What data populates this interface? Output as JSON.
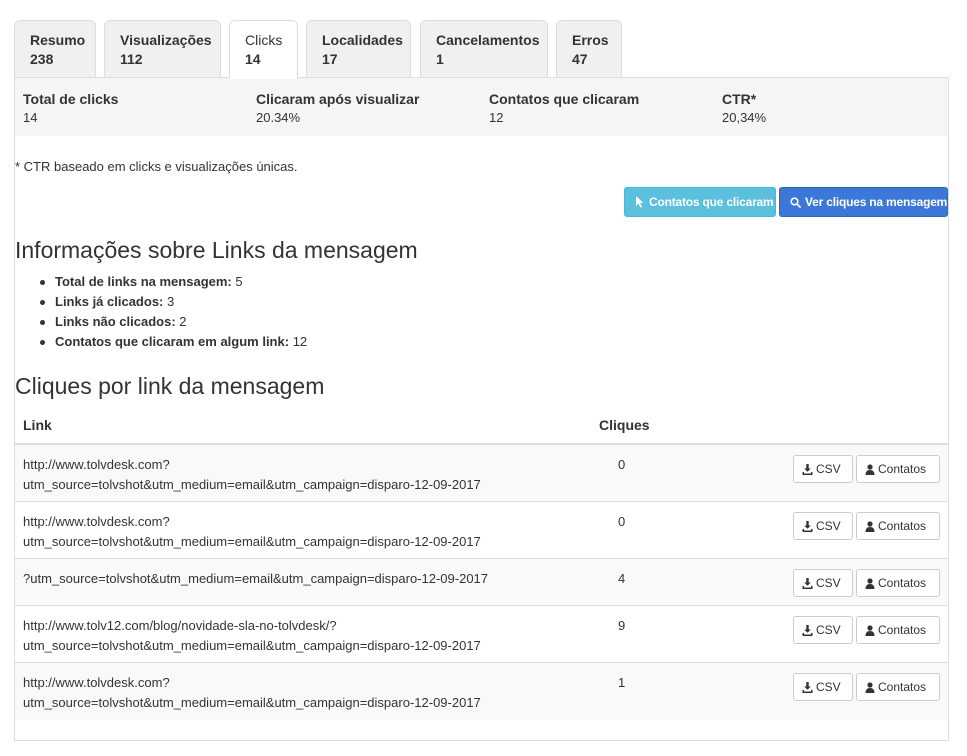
{
  "tabs": [
    {
      "name": "Resumo",
      "count": "238"
    },
    {
      "name": "Visualizações",
      "count": "112"
    },
    {
      "name": "Clicks",
      "count": "14"
    },
    {
      "name": "Localidades",
      "count": "17"
    },
    {
      "name": "Cancelamentos",
      "count": "1"
    },
    {
      "name": "Erros",
      "count": "47"
    }
  ],
  "stats": [
    {
      "label": "Total de clicks",
      "value": "14"
    },
    {
      "label": "Clicaram após visualizar",
      "value": "20.34%"
    },
    {
      "label": "Contatos que clicaram",
      "value": "12"
    },
    {
      "label": "CTR*",
      "value": "20,34%"
    }
  ],
  "note": "* CTR baseado em clicks e visualizações únicas.",
  "buttons": {
    "contacts_clicked": "Contatos que clicaram",
    "view_clicks": "Ver cliques na mensagem"
  },
  "links_info": {
    "title": "Informações sobre Links da mensagem",
    "items": [
      {
        "label": "Total de links na mensagem:",
        "value": "5"
      },
      {
        "label": "Links já clicados:",
        "value": "3"
      },
      {
        "label": "Links não clicados:",
        "value": "2"
      },
      {
        "label": "Contatos que clicaram em algum link:",
        "value": "12"
      }
    ]
  },
  "clicks_table": {
    "title": "Cliques por link da mensagem",
    "headers": {
      "link": "Link",
      "clicks": "Cliques"
    },
    "csv_label": "CSV",
    "contacts_label": "Contatos",
    "rows": [
      {
        "line1": "http://www.tolvdesk.com?",
        "line2": "utm_source=tolvshot&utm_medium=email&utm_campaign=disparo-12-09-2017",
        "clicks": "0"
      },
      {
        "line1": "http://www.tolvdesk.com?",
        "line2": "utm_source=tolvshot&utm_medium=email&utm_campaign=disparo-12-09-2017",
        "clicks": "0"
      },
      {
        "line1": "?utm_source=tolvshot&utm_medium=email&utm_campaign=disparo-12-09-2017",
        "line2": "",
        "clicks": "4"
      },
      {
        "line1": "http://www.tolv12.com/blog/novidade-sla-no-tolvdesk/?",
        "line2": "utm_source=tolvshot&utm_medium=email&utm_campaign=disparo-12-09-2017",
        "clicks": "9"
      },
      {
        "line1": "http://www.tolvdesk.com?",
        "line2": "utm_source=tolvshot&utm_medium=email&utm_campaign=disparo-12-09-2017",
        "clicks": "1"
      }
    ]
  },
  "icons": {
    "pointer": "cursor-pointer-icon",
    "search": "search-icon",
    "download": "download-icon",
    "user": "user-icon"
  },
  "colors": {
    "info_button": "#5bc0de",
    "primary_button": "#3c78d8",
    "stats_background": "#f5f5f5"
  }
}
